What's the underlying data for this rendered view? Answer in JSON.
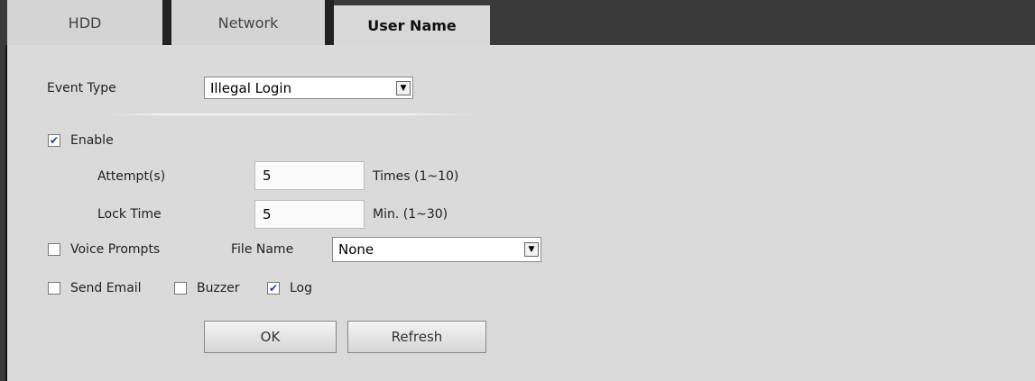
{
  "tabs": [
    {
      "label": "HDD",
      "active": false
    },
    {
      "label": "Network",
      "active": false
    },
    {
      "label": "User Name",
      "active": true
    }
  ],
  "event_type": {
    "label": "Event Type",
    "value": "Illegal Login"
  },
  "enable": {
    "label": "Enable",
    "checked": true
  },
  "attempts": {
    "label": "Attempt(s)",
    "value": "5",
    "unit": "Times (1~10)"
  },
  "lock_time": {
    "label": "Lock Time",
    "value": "5",
    "unit": "Min. (1~30)"
  },
  "voice_prompts": {
    "label": "Voice Prompts",
    "checked": false
  },
  "file_name": {
    "label": "File Name",
    "value": "None"
  },
  "send_email": {
    "label": "Send Email",
    "checked": false
  },
  "buzzer": {
    "label": "Buzzer",
    "checked": false
  },
  "log": {
    "label": "Log",
    "checked": true
  },
  "buttons": {
    "ok": "OK",
    "refresh": "Refresh"
  },
  "colors": {
    "tabbar": "#3a3a3a",
    "content": "#dadada",
    "check": "#1a3da8"
  },
  "icons": {
    "check": "check-icon",
    "dropdown": "dropdown-arrow-icon"
  }
}
